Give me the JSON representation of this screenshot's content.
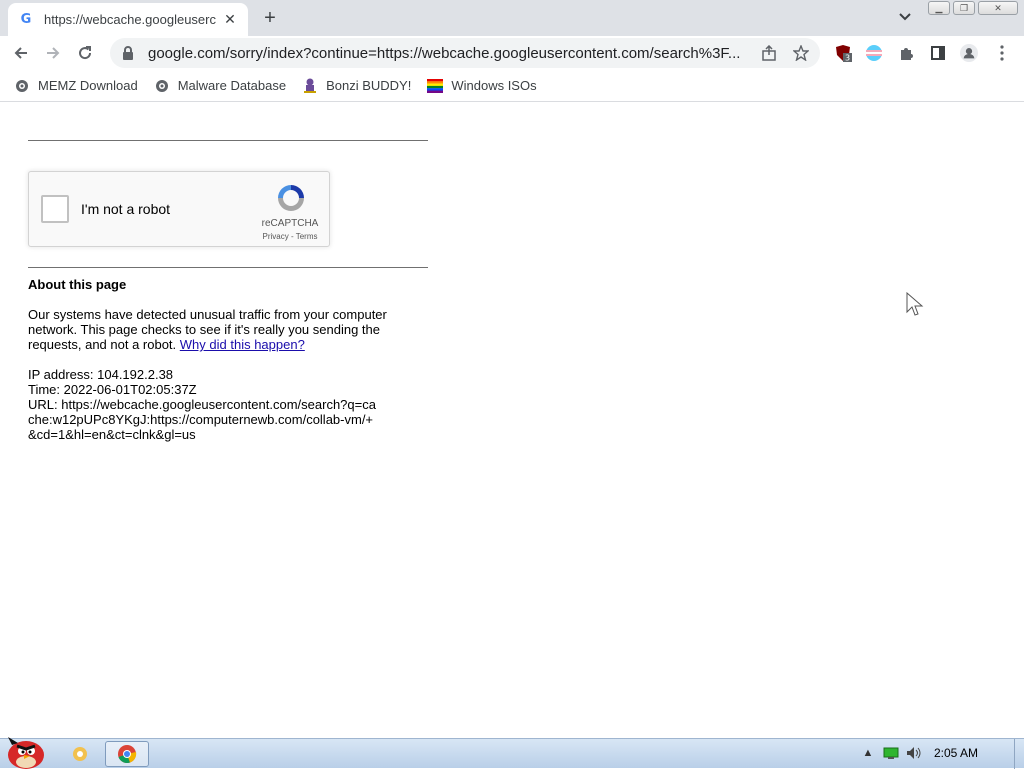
{
  "browser": {
    "tab_title": "https://webcache.googleuserc",
    "url": "google.com/sorry/index?continue=https://webcache.googleusercontent.com/search%3F...",
    "extension_badge": "3",
    "bookmarks": [
      {
        "label": "MEMZ Download",
        "icon": "globe-icon"
      },
      {
        "label": "Malware Database",
        "icon": "globe-icon"
      },
      {
        "label": "Bonzi BUDDY!",
        "icon": "bonzi-icon"
      },
      {
        "label": "Windows ISOs",
        "icon": "rainbow-flag-icon"
      }
    ]
  },
  "page": {
    "recaptcha_label": "I'm not a robot",
    "recaptcha_brand": "reCAPTCHA",
    "recaptcha_terms": "Privacy - Terms",
    "about_title": "About this page",
    "paragraph": "Our systems have detected unusual traffic from your computer network. This page checks to see if it's really you sending the requests, and not a robot.",
    "why_link": "Why did this happen?",
    "ip_line": "IP address: 104.192.2.38",
    "time_line": "Time: 2022-06-01T02:05:37Z",
    "url_line": "URL: https://webcache.googleusercontent.com/search?q=cache:w12pUPc8YKgJ:https://computernewb.com/collab-vm/+&cd=1&hl=en&ct=clnk&gl=us"
  },
  "taskbar": {
    "clock": "2:05 AM"
  },
  "colors": {
    "link": "#1a0dab",
    "chrome_frame": "#dee1e6",
    "taskbar": "#c8daef"
  }
}
